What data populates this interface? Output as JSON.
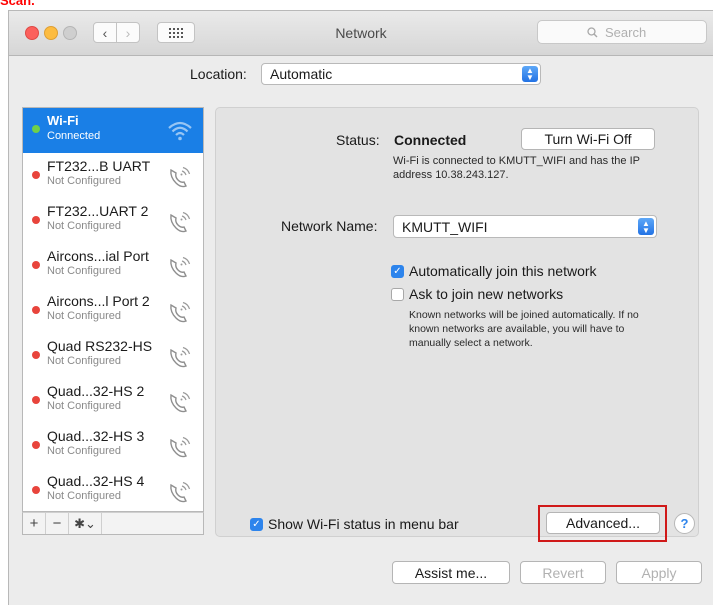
{
  "crop_text": "Scan.",
  "window": {
    "title": "Network",
    "search_placeholder": "Search"
  },
  "location": {
    "label": "Location:",
    "value": "Automatic"
  },
  "services": [
    {
      "name": "Wi-Fi",
      "status": "Connected",
      "icon": "wifi-icon",
      "selected": true
    },
    {
      "name": "FT232...B UART",
      "status": "Not Configured",
      "icon": "phone-icon"
    },
    {
      "name": "FT232...UART 2",
      "status": "Not Configured",
      "icon": "phone-icon"
    },
    {
      "name": "Aircons...ial Port",
      "status": "Not Configured",
      "icon": "phone-icon"
    },
    {
      "name": "Aircons...l Port 2",
      "status": "Not Configured",
      "icon": "phone-icon"
    },
    {
      "name": "Quad RS232-HS",
      "status": "Not Configured",
      "icon": "phone-icon"
    },
    {
      "name": "Quad...32-HS 2",
      "status": "Not Configured",
      "icon": "phone-icon"
    },
    {
      "name": "Quad...32-HS 3",
      "status": "Not Configured",
      "icon": "phone-icon"
    },
    {
      "name": "Quad...32-HS 4",
      "status": "Not Configured",
      "icon": "phone-icon"
    }
  ],
  "sidebar_footer": {
    "add": "+",
    "remove": "−",
    "gear": "✱⌄"
  },
  "detail": {
    "status_label": "Status:",
    "status_value": "Connected",
    "wifi_off_button": "Turn Wi-Fi Off",
    "status_description": "Wi-Fi is connected to KMUTT_WIFI and has the IP address 10.38.243.127.",
    "network_name_label": "Network Name:",
    "network_name_value": "KMUTT_WIFI",
    "auto_join_label": "Automatically join this network",
    "auto_join_checked": true,
    "ask_join_label": "Ask to join new networks",
    "ask_join_checked": false,
    "ask_description": "Known networks will be joined automatically. If no known networks are available, you will have to manually select a network.",
    "show_status_label": "Show Wi-Fi status in menu bar",
    "show_status_checked": true,
    "advanced_button": "Advanced...",
    "help_button": "?"
  },
  "bottom": {
    "assist": "Assist me...",
    "revert": "Revert",
    "apply": "Apply"
  },
  "colors": {
    "selection": "#1a7fe6",
    "accent": "#2d84ec",
    "highlight_box": "#d01919",
    "connected_dot": "#6fd04a",
    "not_configured_dot": "#e8443c"
  }
}
